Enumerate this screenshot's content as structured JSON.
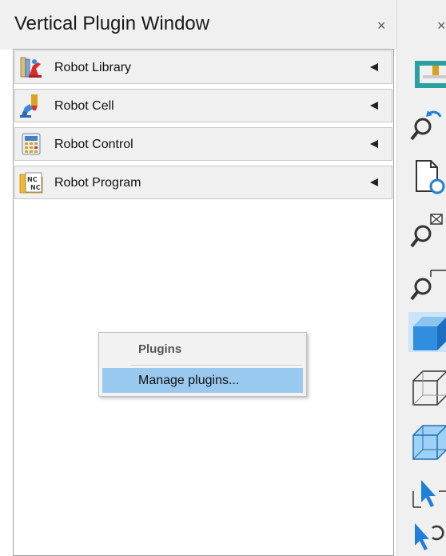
{
  "panel": {
    "title": "Vertical Plugin Window",
    "close_symbol": "×",
    "items": [
      {
        "label": "Robot Library",
        "icon": "robot-library-icon"
      },
      {
        "label": "Robot Cell",
        "icon": "robot-cell-icon"
      },
      {
        "label": "Robot Control",
        "icon": "robot-control-icon"
      },
      {
        "label": "Robot Program",
        "icon": "robot-program-icon"
      }
    ]
  },
  "context_menu": {
    "header": "Plugins",
    "items": [
      {
        "label": "Manage plugins..."
      }
    ],
    "highlight_color": "#99c9ef"
  },
  "right_panel": {
    "close_symbol": "×",
    "tools": [
      "station-icon",
      "refresh-view-icon",
      "reload-document-icon",
      "zoom-fit-icon",
      "zoom-window-icon",
      "shaded-view-icon",
      "wireframe-view-icon",
      "transparent-view-icon",
      "select-icon",
      "select-rotate-icon"
    ]
  },
  "colors": {
    "accent": "#99c9ef",
    "blue_tool": "#2f8ee0"
  }
}
